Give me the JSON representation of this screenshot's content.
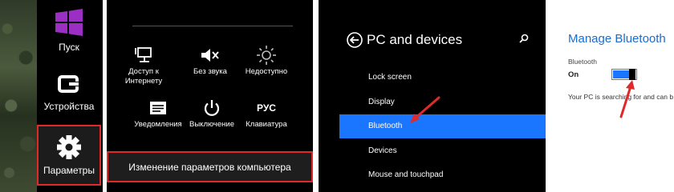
{
  "charms": {
    "start_label": "Пуск",
    "devices_label": "Устройства",
    "settings_label": "Параметры"
  },
  "settings_flyout": {
    "quick_settings": [
      {
        "label_line1": "Доступ к",
        "label_line2": "Интернету",
        "icon": "network-icon"
      },
      {
        "label_line1": "Без звука",
        "label_line2": "",
        "icon": "mute-icon"
      },
      {
        "label_line1": "Недоступно",
        "label_line2": "",
        "icon": "brightness-icon"
      },
      {
        "label_line1": "Уведомления",
        "label_line2": "",
        "icon": "notifications-icon"
      },
      {
        "label_line1": "Выключение",
        "label_line2": "",
        "icon": "power-icon"
      },
      {
        "label_line1": "Клавиатура",
        "label_line2": "",
        "icon": "keyboard-icon",
        "icon_text": "РУС"
      }
    ],
    "change_settings_label": "Изменение параметров компьютера"
  },
  "pc_devices": {
    "title": "PC and devices",
    "nav": [
      {
        "label": "Lock screen",
        "selected": false
      },
      {
        "label": "Display",
        "selected": false
      },
      {
        "label": "Bluetooth",
        "selected": true
      },
      {
        "label": "Devices",
        "selected": false
      },
      {
        "label": "Mouse and touchpad",
        "selected": false
      }
    ]
  },
  "bluetooth": {
    "heading": "Manage Bluetooth",
    "toggle_label": "Bluetooth",
    "toggle_state": "On",
    "status": "Your PC is searching for and can b"
  },
  "colors": {
    "accent": "#1a75ff",
    "highlight_border": "#e02a2a",
    "heading_blue": "#1a6bd2"
  }
}
